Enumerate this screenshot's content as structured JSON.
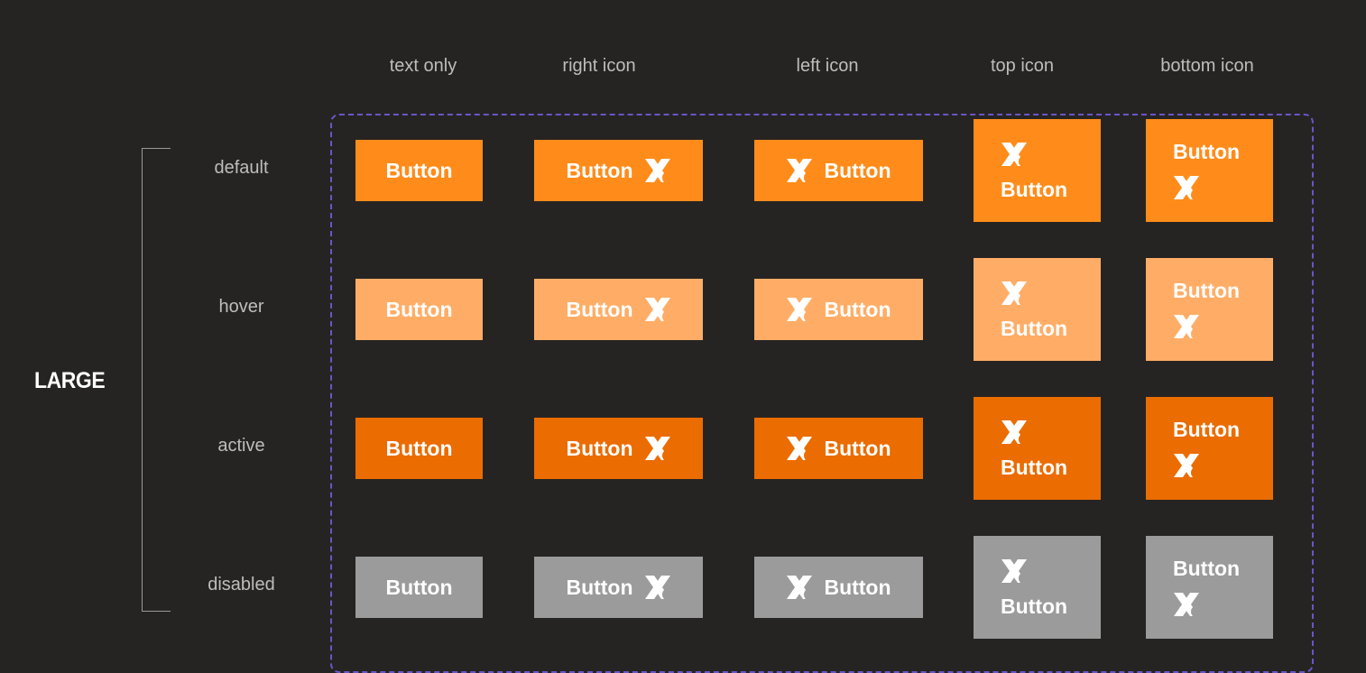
{
  "size_label": "LARGE",
  "columns": [
    {
      "key": "text",
      "label": "text only"
    },
    {
      "key": "right",
      "label": "right icon"
    },
    {
      "key": "left",
      "label": "left icon"
    },
    {
      "key": "top",
      "label": "top icon"
    },
    {
      "key": "bottom",
      "label": "bottom icon"
    }
  ],
  "states": [
    {
      "key": "default",
      "label": "default",
      "color": "#ff8c1a"
    },
    {
      "key": "hover",
      "label": "hover",
      "color": "#ffad66"
    },
    {
      "key": "active",
      "label": "active",
      "color": "#eb6c00"
    },
    {
      "key": "disabled",
      "label": "disabled",
      "color": "#9b9b9b"
    }
  ],
  "button_label": "Button",
  "icon_name": "brand-x-icon",
  "colors": {
    "background": "#262422",
    "frame_border": "#6a55c8",
    "label_text": "#bdbdbd"
  }
}
